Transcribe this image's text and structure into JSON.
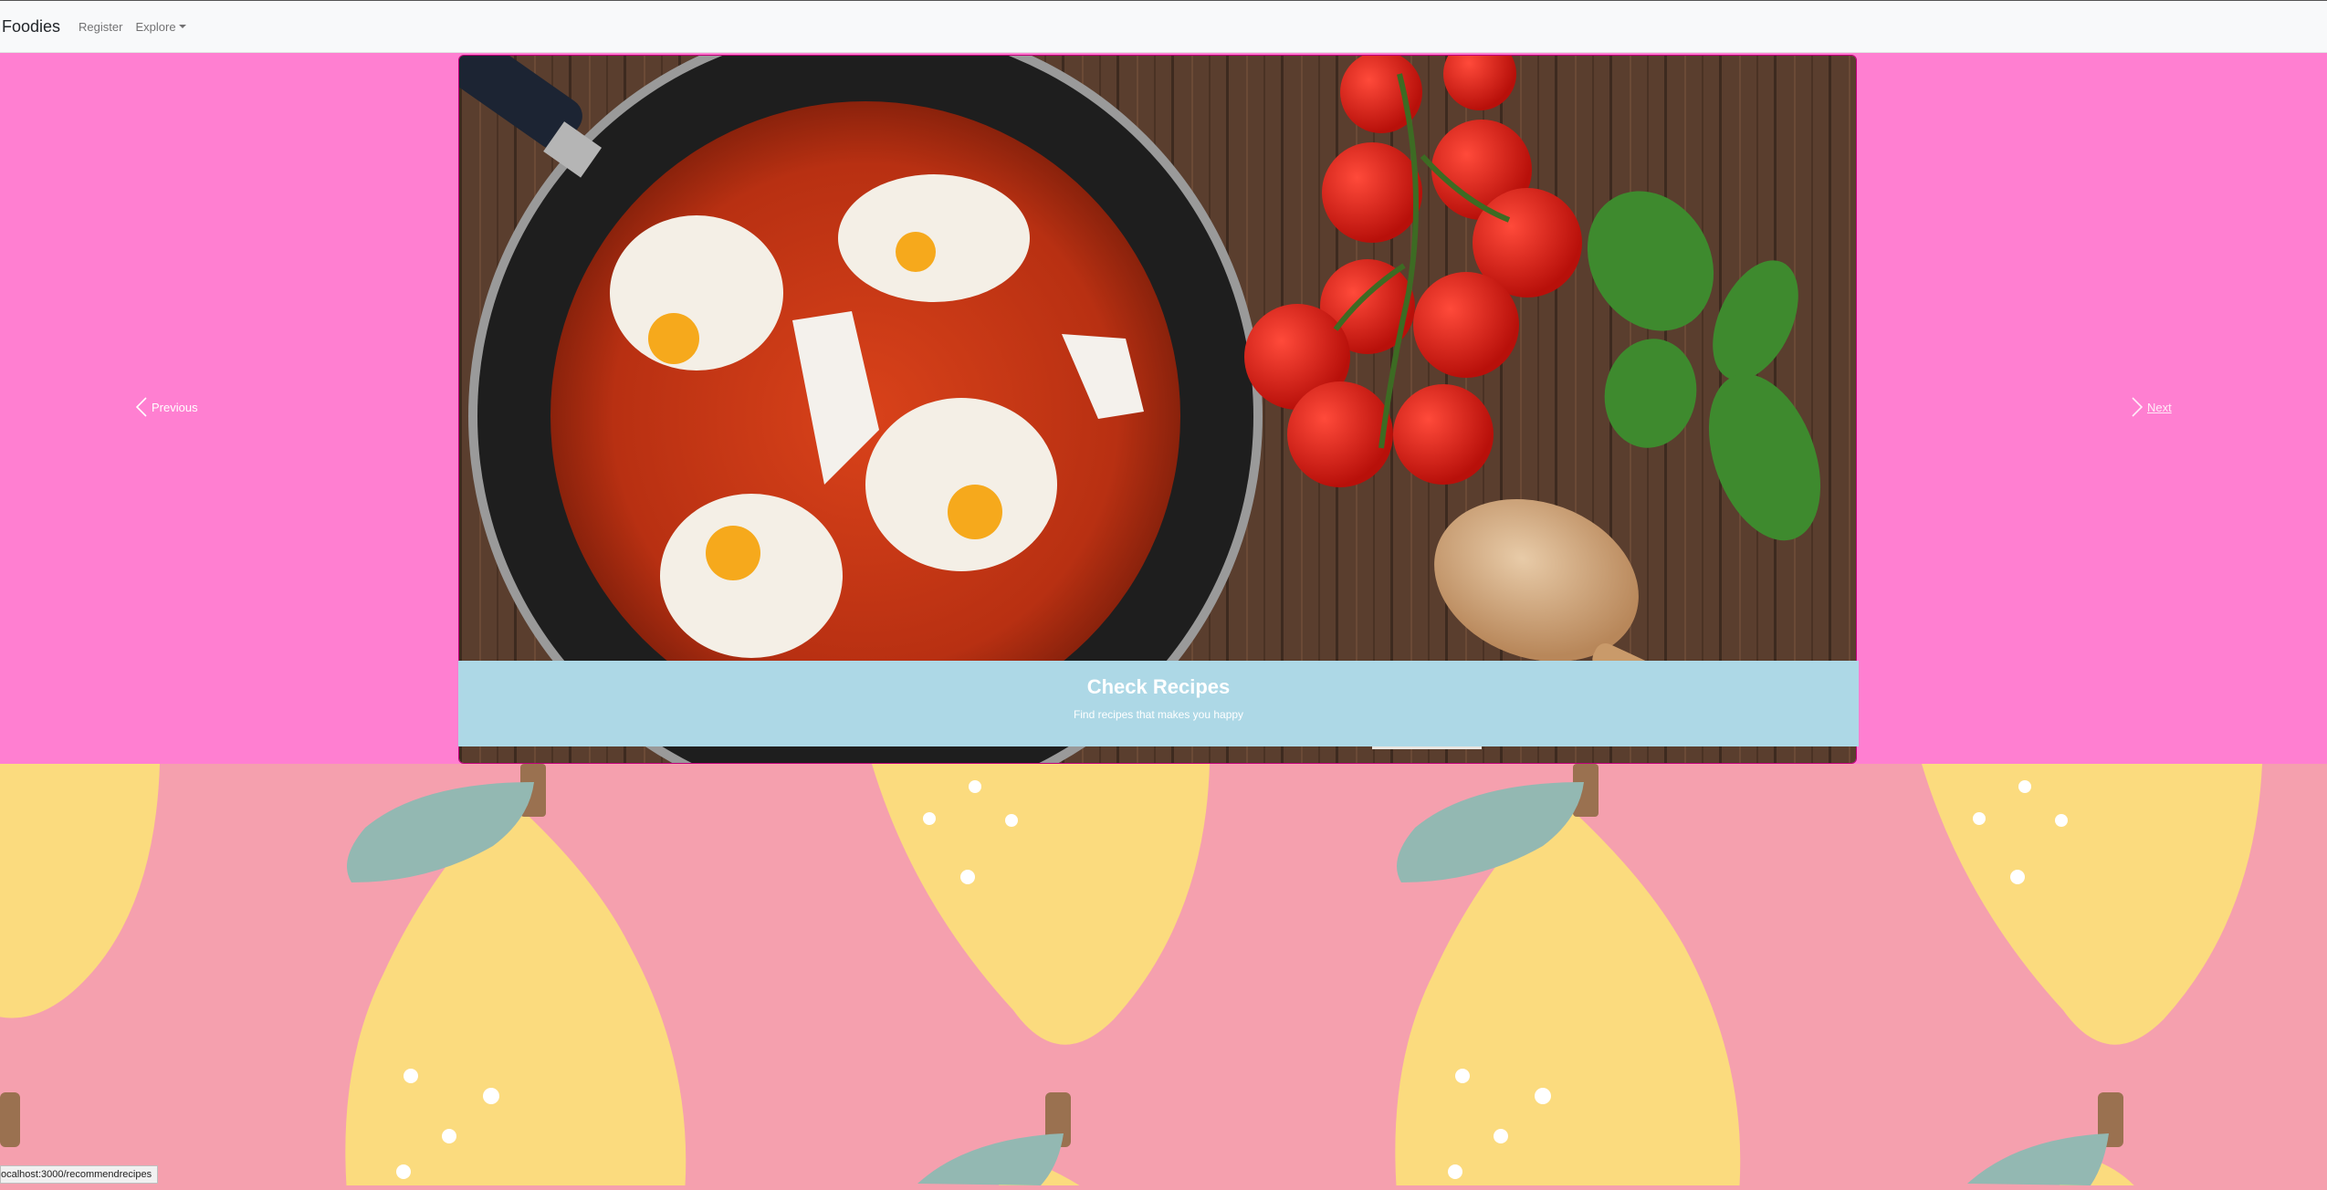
{
  "navbar": {
    "brand": "Foodies",
    "links": [
      "Register",
      "Explore"
    ]
  },
  "carousel": {
    "prev_label": "Previous",
    "next_label": "Next",
    "caption_title": "Check Recipes",
    "caption_text": "Find recipes that makes you happy"
  },
  "status_bar": {
    "url": "ocalhost:3000/recommendrecipes"
  },
  "colors": {
    "hero_bg": "#ff7fd1",
    "caption_bg": "#add8e6",
    "lemon_bg": "#f5a0ae",
    "lemon": "#fbdb7e",
    "leaf": "#93b8b2"
  }
}
